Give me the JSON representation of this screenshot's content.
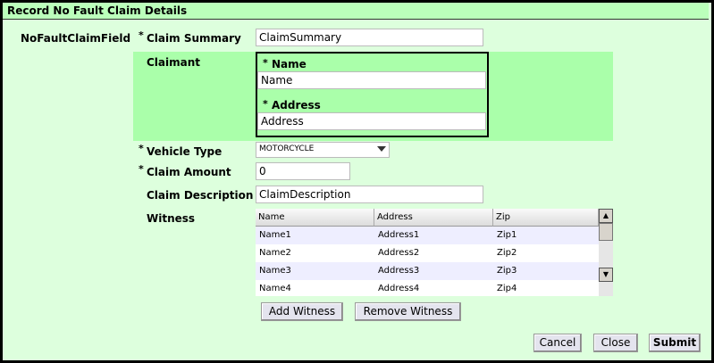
{
  "title": "Record No Fault Claim Details",
  "field_label": "NoFaultClaimField",
  "required_mark": "*",
  "claim_summary": {
    "label": "Claim Summary",
    "value": "ClaimSummary"
  },
  "claimant": {
    "label": "Claimant",
    "name_label": "Name",
    "name_value": "Name",
    "address_label": "Address",
    "address_value": "Address"
  },
  "vehicle_type": {
    "label": "Vehicle Type",
    "value": "MOTORCYCLE"
  },
  "claim_amount": {
    "label": "Claim Amount",
    "value": "0"
  },
  "claim_description": {
    "label": "Claim Description",
    "value": "ClaimDescription"
  },
  "witness": {
    "label": "Witness",
    "columns": [
      "Name",
      "Address",
      "Zip"
    ],
    "rows": [
      [
        "Name1",
        "Address1",
        "Zip1"
      ],
      [
        "Name2",
        "Address2",
        "Zip2"
      ],
      [
        "Name3",
        "Address3",
        "Zip3"
      ],
      [
        "Name4",
        "Address4",
        "Zip4"
      ]
    ]
  },
  "buttons": {
    "add_witness": "Add Witness",
    "remove_witness": "Remove Witness",
    "cancel": "Cancel",
    "close": "Close",
    "submit": "Submit"
  }
}
